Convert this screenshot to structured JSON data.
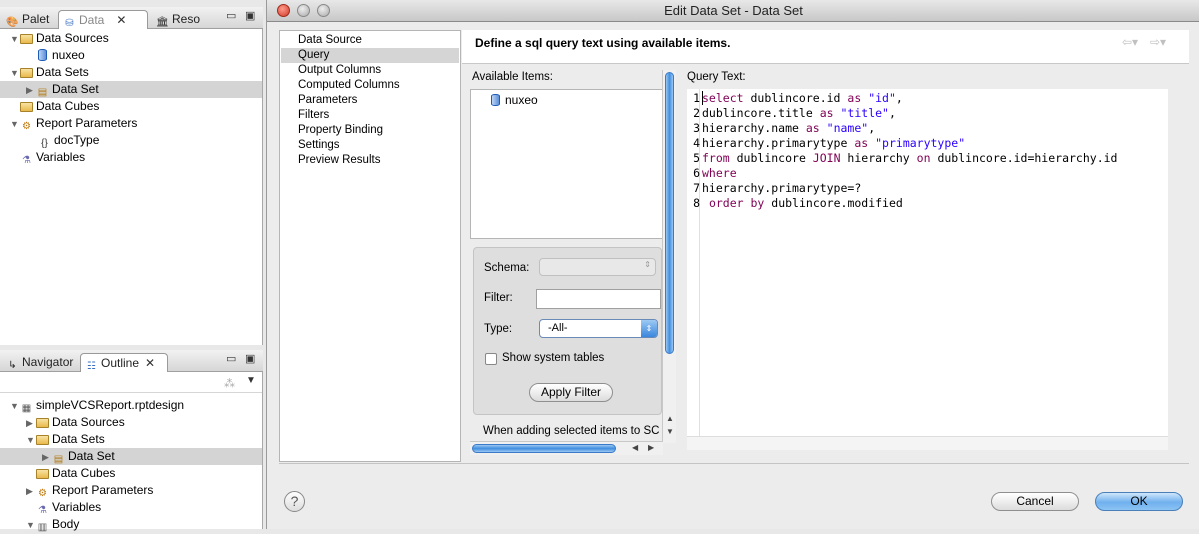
{
  "data_pane": {
    "tabs": [
      "Palet",
      "Data",
      "Reso"
    ],
    "tree": [
      {
        "label": "Data Sources",
        "level": 0,
        "icon": "data-sources-icon",
        "expanded": true
      },
      {
        "label": "nuxeo",
        "level": 1,
        "icon": "database-icon"
      },
      {
        "label": "Data Sets",
        "level": 0,
        "icon": "data-sets-icon",
        "expanded": true
      },
      {
        "label": "Data Set",
        "level": 1,
        "icon": "data-set-icon",
        "selected": true
      },
      {
        "label": "Data Cubes",
        "level": 0,
        "icon": "data-cubes-icon"
      },
      {
        "label": "Report Parameters",
        "level": 0,
        "icon": "report-parameters-icon",
        "expanded": true
      },
      {
        "label": "docType",
        "level": 1,
        "icon": "parameter-icon"
      },
      {
        "label": "Variables",
        "level": 0,
        "icon": "variables-icon"
      }
    ]
  },
  "outline_pane": {
    "tabs": [
      "Navigator",
      "Outline"
    ],
    "tree": [
      {
        "label": "simpleVCSReport.rptdesign",
        "level": 0,
        "expanded": true
      },
      {
        "label": "Data Sources",
        "level": 1
      },
      {
        "label": "Data Sets",
        "level": 1,
        "expanded": true
      },
      {
        "label": "Data Set",
        "level": 2,
        "selected": true
      },
      {
        "label": "Data Cubes",
        "level": 1
      },
      {
        "label": "Report Parameters",
        "level": 1
      },
      {
        "label": "Variables",
        "level": 1
      },
      {
        "label": "Body",
        "level": 1
      }
    ]
  },
  "dialog": {
    "title": "Edit Data Set - Data Set",
    "nav": [
      "Data Source",
      "Query",
      "Output Columns",
      "Computed Columns",
      "Parameters",
      "Filters",
      "Property Binding",
      "Settings",
      "Preview Results"
    ],
    "nav_selected": "Query",
    "header": "Define a sql query text using available items.",
    "available_items_label": "Available Items:",
    "available_items": [
      "nuxeo"
    ],
    "schema_label": "Schema:",
    "filter_label": "Filter:",
    "filter_value": "",
    "type_label": "Type:",
    "type_value": "-All-",
    "show_system_tables": "Show system tables",
    "apply_filter": "Apply Filter",
    "adding_note": "When adding selected items to SC",
    "query_label": "Query Text:",
    "query_lines": [
      "select dublincore.id as \"id\",",
      "dublincore.title as \"title\",",
      "hierarchy.name as \"name\",",
      "hierarchy.primarytype as \"primarytype\"",
      "from dublincore JOIN hierarchy on dublincore.id=hierarchy.id",
      "where",
      "hierarchy.primarytype=?",
      " order by dublincore.modified"
    ],
    "cancel": "Cancel",
    "ok": "OK",
    "help": "?"
  }
}
